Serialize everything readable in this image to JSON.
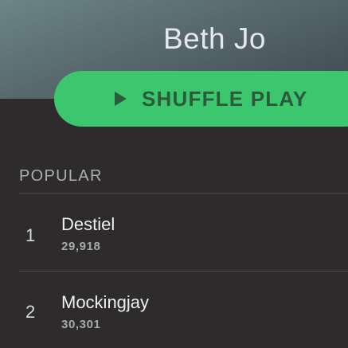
{
  "artist": {
    "name": "Beth Jo"
  },
  "actions": {
    "shuffle_label": "SHUFFLE PLAY",
    "play_icon": "play-icon"
  },
  "popular": {
    "title": "POPULAR",
    "tracks": [
      {
        "number": "1",
        "title": "Destiel",
        "plays": "29,918"
      },
      {
        "number": "2",
        "title": "Mockingjay",
        "plays": "30,301"
      }
    ]
  },
  "colors": {
    "accent": "#3cc76f",
    "background": "#2d2b2c",
    "header": "#5f7477"
  }
}
